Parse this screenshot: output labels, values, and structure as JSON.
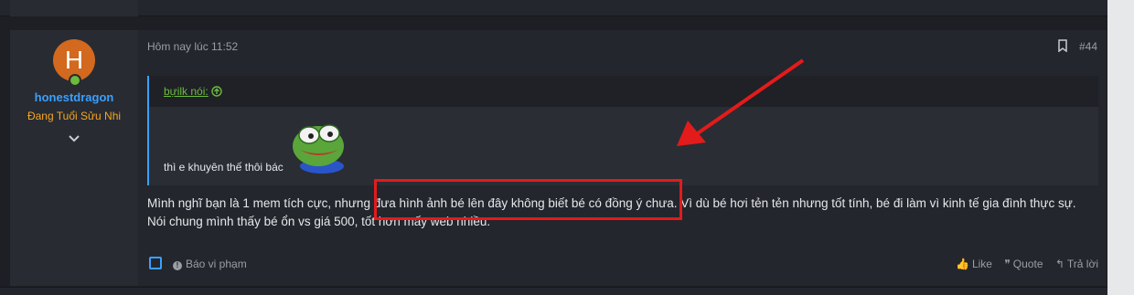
{
  "post": {
    "timestamp": "Hôm nay lúc 11:52",
    "number": "#44",
    "user": {
      "avatar_letter": "H",
      "avatar_color": "#d2691e",
      "username": "honestdragon",
      "title": "Đang Tuổi Sửu Nhi",
      "online": true
    },
    "quote": {
      "author": "bựilk nói:",
      "text": "thì e khuyên thế thôi bác",
      "sticker": "pepe-frog-sticker"
    },
    "body_line1": "Mình nghĩ bạn là 1 mem tích cực, nhưng đưa hình ảnh bé lên đây không biết bé có đồng ý chưa. Vì dù bé hơi tẻn tẻn nhưng tốt tính, bé đi làm vì kinh tế gia đình thực sự.",
    "body_line2": "Nói chung mình thấy bé ổn vs giá 500, tốt hơn mấy web nhiều.",
    "footer": {
      "report": "Báo vi phạm",
      "like": "Like",
      "quote": "Quote",
      "reply": "Trả lời"
    }
  },
  "colors": {
    "accent": "#3aa0ff",
    "username": "#3aa0ff",
    "user_title": "#f5a623",
    "online": "#6cbb3c",
    "annotation": "#e31b1b"
  }
}
